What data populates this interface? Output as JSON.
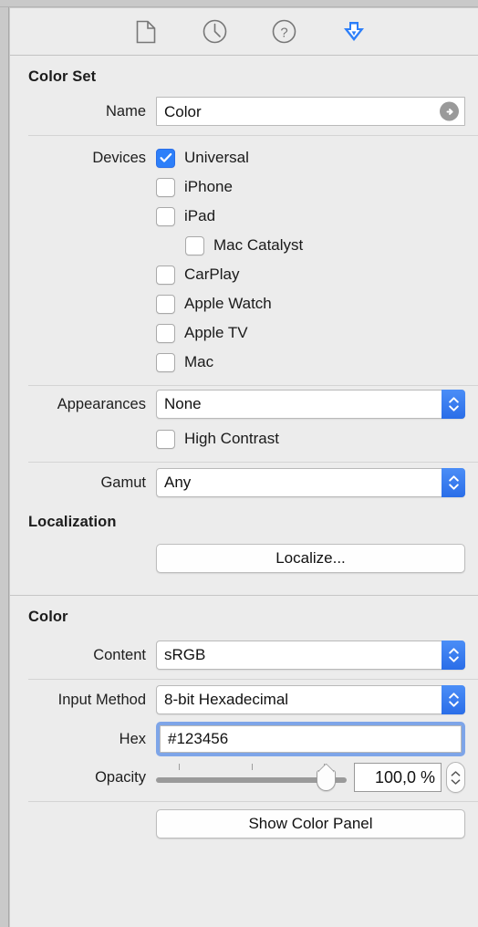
{
  "toolbar": {
    "items": [
      {
        "name": "file-inspector-icon",
        "label": "File Inspector",
        "selected": false
      },
      {
        "name": "history-inspector-icon",
        "label": "History Inspector",
        "selected": false
      },
      {
        "name": "help-inspector-icon",
        "label": "Quick Help Inspector",
        "selected": false
      },
      {
        "name": "attributes-inspector-icon",
        "label": "Attributes Inspector",
        "selected": true
      }
    ],
    "accent_color": "#2d7ff9"
  },
  "color_set": {
    "title": "Color Set",
    "name": {
      "label": "Name",
      "value": "Color",
      "arrow_icon": "circle-right-arrow-icon"
    },
    "devices": {
      "label": "Devices",
      "items": [
        {
          "label": "Universal",
          "checked": true,
          "indent": 0
        },
        {
          "label": "iPhone",
          "checked": false,
          "indent": 0
        },
        {
          "label": "iPad",
          "checked": false,
          "indent": 0
        },
        {
          "label": "Mac Catalyst",
          "checked": false,
          "indent": 1
        },
        {
          "label": "CarPlay",
          "checked": false,
          "indent": 0
        },
        {
          "label": "Apple Watch",
          "checked": false,
          "indent": 0
        },
        {
          "label": "Apple TV",
          "checked": false,
          "indent": 0
        },
        {
          "label": "Mac",
          "checked": false,
          "indent": 0
        }
      ]
    },
    "appearances": {
      "label": "Appearances",
      "value": "None"
    },
    "high_contrast": {
      "label": "High Contrast",
      "checked": false
    },
    "gamut": {
      "label": "Gamut",
      "value": "Any"
    }
  },
  "localization": {
    "title": "Localization",
    "localize_button": "Localize..."
  },
  "color": {
    "title": "Color",
    "content": {
      "label": "Content",
      "value": "sRGB"
    },
    "input_method": {
      "label": "Input Method",
      "value": "8-bit Hexadecimal"
    },
    "hex": {
      "label": "Hex",
      "value": "#123456",
      "focused": true,
      "focus_ring_color": "#7ea5e8"
    },
    "opacity": {
      "label": "Opacity",
      "value": "100,0 %",
      "percent": 100
    },
    "show_color_panel_button": "Show Color Panel"
  }
}
